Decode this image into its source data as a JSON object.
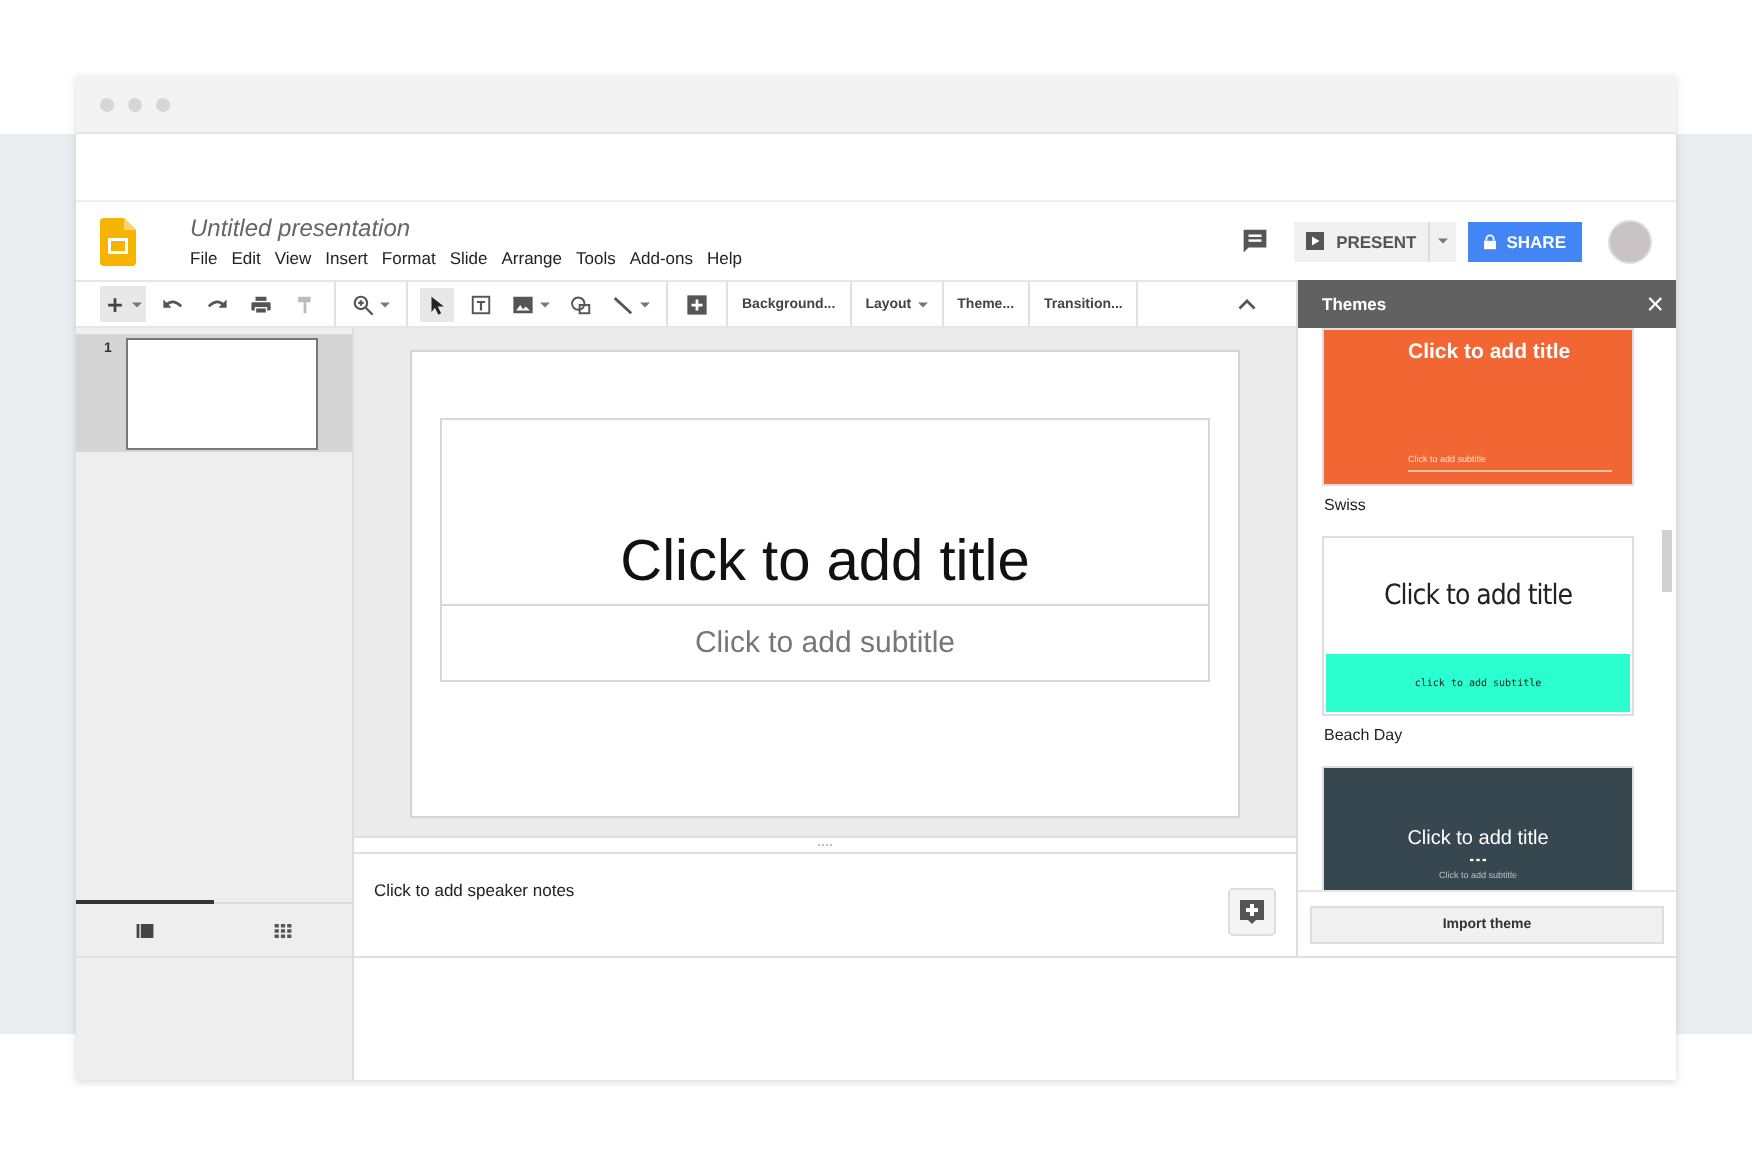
{
  "document": {
    "title": "Untitled presentation"
  },
  "menu": [
    "File",
    "Edit",
    "View",
    "Insert",
    "Format",
    "Slide",
    "Arrange",
    "Tools",
    "Add-ons",
    "Help"
  ],
  "header": {
    "present": "PRESENT",
    "share": "SHARE"
  },
  "toolbar": {
    "text_buttons": [
      {
        "label": "Background...",
        "caret": false
      },
      {
        "label": "Layout",
        "caret": true
      },
      {
        "label": "Theme...",
        "caret": false
      },
      {
        "label": "Transition...",
        "caret": false
      }
    ]
  },
  "slides": [
    {
      "number": "1",
      "selected": true
    }
  ],
  "view_tabs": [
    {
      "kind": "filmstrip",
      "selected": true
    },
    {
      "kind": "grid",
      "selected": false
    }
  ],
  "slide": {
    "title": "Click to add title",
    "subtitle": "Click to add subtitle"
  },
  "notes": {
    "placeholder": "Click to add speaker notes"
  },
  "themes_panel": {
    "title": "Themes",
    "close": "×",
    "themes": [
      {
        "kind": "line",
        "color": "#f26633",
        "title": "Click to add title",
        "subtitle": "Click to add subtitle",
        "name": "Swiss"
      },
      {
        "kind": "band",
        "color": "#2bffcf",
        "title": "Click to add title",
        "subtitle": "click to add subtitle",
        "name": "Beach Day"
      },
      {
        "kind": "dots",
        "color": "#37474f",
        "title": "Click to add title",
        "subtitle": "Click to add subtitle"
      }
    ],
    "import_button": "Import theme"
  }
}
